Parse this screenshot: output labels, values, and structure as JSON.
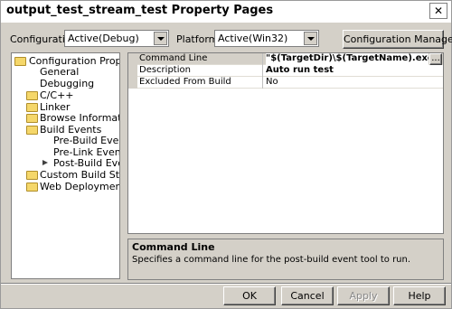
{
  "window": {
    "title": "output_test_stream_test Property Pages",
    "close_glyph": "✕"
  },
  "toolbar": {
    "configuration_label": "Configuration:",
    "configuration_value": "Active(Debug)",
    "platform_label": "Platform:",
    "platform_value": "Active(Win32)",
    "configuration_manager_button": "Configuration Manager..."
  },
  "tree": {
    "items": [
      {
        "label": "Configuration Properties",
        "icon": "open-folder-icon"
      },
      {
        "label": "General"
      },
      {
        "label": "Debugging"
      },
      {
        "label": "C/C++",
        "icon": "folder-icon"
      },
      {
        "label": "Linker",
        "icon": "folder-icon"
      },
      {
        "label": "Browse Information",
        "icon": "folder-icon"
      },
      {
        "label": "Build Events",
        "icon": "open-folder-icon"
      },
      {
        "label": "Pre-Build Event"
      },
      {
        "label": "Pre-Link Event"
      },
      {
        "label": "Post-Build Event",
        "icon": "arrow-icon",
        "selected": true
      },
      {
        "label": "Custom Build Step",
        "icon": "folder-icon"
      },
      {
        "label": "Web Deployment",
        "icon": "folder-icon"
      }
    ]
  },
  "properties": {
    "rows": [
      {
        "key": "Command Line",
        "value": "\"$(TargetDir)\\$(TargetName).exe\" --res",
        "selected": true
      },
      {
        "key": "Description",
        "value": "Auto run test",
        "bold": true
      },
      {
        "key": "Excluded From Build",
        "value": "No"
      }
    ],
    "ellipsis_button": "..."
  },
  "description": {
    "heading": "Command Line",
    "text": "Specifies a command line for the post-build event tool to run."
  },
  "buttons": {
    "ok": "OK",
    "cancel": "Cancel",
    "apply": "Apply",
    "help": "Help"
  },
  "colors": {
    "dialog_bg": "#d4d0c8",
    "selected_row": "#d4d0c8"
  }
}
